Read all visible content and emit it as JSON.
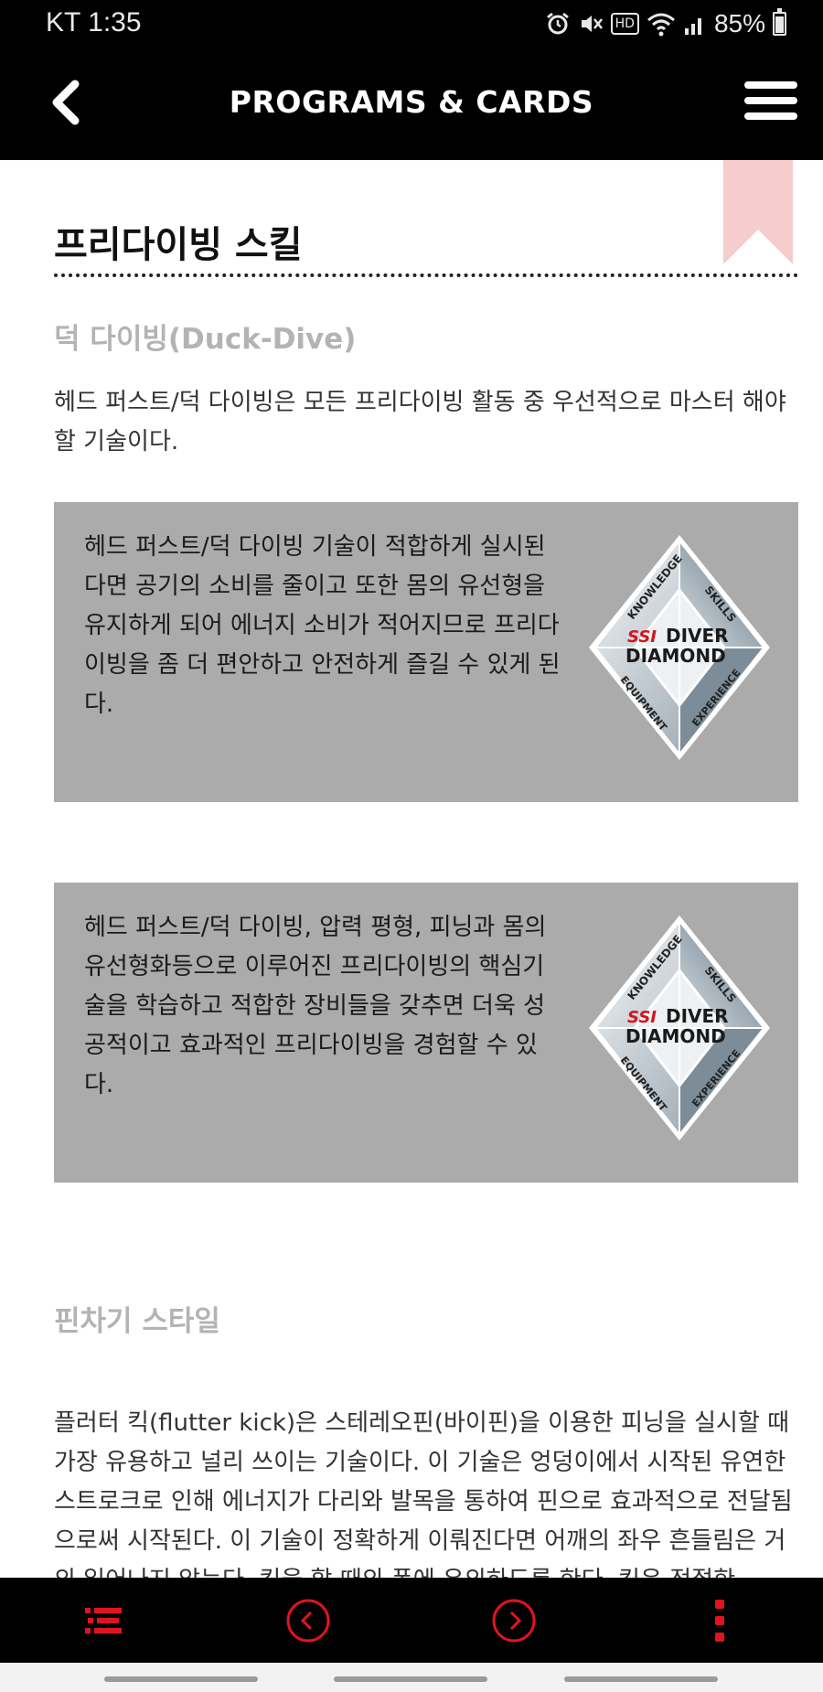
{
  "status_bar": {
    "time": "KT 1:35",
    "battery_percent": "85%",
    "icons": [
      "alarm-icon",
      "mute-icon",
      "hd-icon",
      "wifi-icon",
      "signal-icon",
      "battery-icon"
    ],
    "hd_label": "HD"
  },
  "header": {
    "title": "PROGRAMS & CARDS",
    "back_icon": "chevron-left-icon",
    "menu_icon": "hamburger-menu-icon"
  },
  "content": {
    "page_title": "프리다이빙 스킬",
    "section1_title": "덕 다이빙(Duck-Dive)",
    "section1_text": "헤드 퍼스트/덕 다이빙은 모든 프리다이빙 활동 중 우선적으로 마스터 해야 할 기술이다.",
    "cards": [
      {
        "text": "헤드 퍼스트/덕 다이빙 기술이 적합하게 실시된다면 공기의 소비를 줄이고 또한 몸의 유선형을 유지하게 되어 에너지 소비가 적어지므로 프리다이빙을 좀 더 편안하고 안전하게 즐길 수 있게 된다."
      },
      {
        "text": "헤드 퍼스트/덕 다이빙, 압력 평형, 피닝과 몸의 유선형화등으로 이루어진 프리다이빙의 핵심기술을 학습하고 적합한 장비들을 갖추면 더욱 성공적이고 효과적인 프리다이빙을 경험할 수 있다."
      }
    ],
    "badge": {
      "logo": "SSI",
      "line1": "DIVER",
      "line2": "DIAMOND",
      "knowledge": "KNOWLEDGE",
      "skills": "SKILLS",
      "equipment": "EQUIPMENT",
      "experience": "EXPERIENCE"
    },
    "section2_title": "핀차기 스타일",
    "section2_text": "플러터 킥(flutter kick)은 스테레오핀(바이핀)을 이용한 피닝을 실시할 때 가장 유용하고 널리 쓰이는 기술이다. 이 기술은 엉덩이에서 시작된 유연한 스트로크로 인해 에너지가 다리와 발목을 통하여 핀으로 효과적으로 전달됨으로써 시작된다. 이 기술이 정확하게 이뤄진다면 어깨의 좌우 흔들림은 거의 일어나지 않는다. 킥을 할 때의 폭에 유의하도록 한다. 킥은 적절한"
  },
  "bottom_nav": {
    "items": [
      "list-icon",
      "previous-icon",
      "next-icon",
      "more-vertical-icon"
    ]
  },
  "colors": {
    "accent_red": "#e0141e",
    "card_bg": "#ababab",
    "bookmark": "#f6cccc",
    "subhead_gray": "#b3b3b3"
  }
}
